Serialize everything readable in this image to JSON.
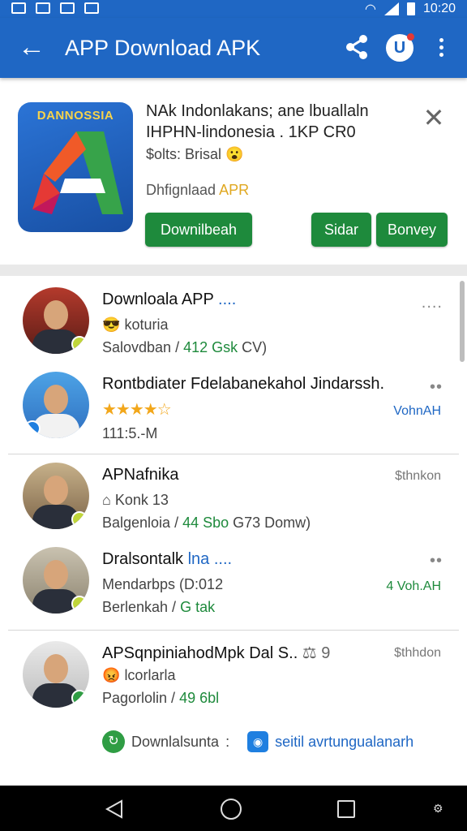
{
  "status_bar": {
    "time": "10:20"
  },
  "app_bar": {
    "title": "APP Download APK",
    "badge": "U"
  },
  "top_card": {
    "logo_text": "DANNOSSIA",
    "title": "NAk Indonlakans; ane lbuallaln IHPHN-lindonesia . 1KP CR0",
    "subtitle": "$olts: Brisal",
    "subtitle_emoji": "😮",
    "download_prefix": "Dhfignlaad ",
    "download_accent": "APR",
    "buttons": {
      "primary": "Downilbeah",
      "second": "Sidar",
      "third": "Bonvey"
    }
  },
  "list": [
    {
      "name": "Downloala APP",
      "name_accent": " ....",
      "sub_icon": "😎",
      "sub": "koturia",
      "meta": "Salovdban / ",
      "meta_green": "412 Gsk",
      "meta_tail": " CV)",
      "right": "....",
      "right_type": "dots"
    },
    {
      "name": "Rontbdiater Fdelabanekahol Jindarssh.",
      "sub_stars": "★★★★☆",
      "meta": "111:5.-M",
      "right": "••",
      "right_type": "dots",
      "right2": "VohnAH",
      "right2_type": "blue"
    },
    {
      "name": "APNafnika",
      "sub_icon": "⌂",
      "sub": "Konk 13",
      "meta": "Balgenloia / ",
      "meta_green": "44 Sbo",
      "meta_tail": " G73 Domw)",
      "right": "$thnkon",
      "right_type": "gray"
    },
    {
      "name": "Dralsontalk",
      "name_accent": " lna ....",
      "sub": "Mendarbps (D:012",
      "meta": "Berlenkah / ",
      "meta_green": "G tak",
      "right": "••",
      "right_type": "dots",
      "right2": "4 Voh.AH",
      "right2_type": "green"
    },
    {
      "name": "APSqnpiniahodMpk Dal S..",
      "name_tail": " ⚖ 9",
      "sub_icon": "😡",
      "sub": "lcorlarla",
      "meta": "Pagorlolin / ",
      "meta_green": "49 6bl",
      "right": "$thhdon",
      "right_type": "gray"
    }
  ],
  "footer": {
    "left": "Downlalsunta",
    "sep": ":",
    "link": "seitil avrtungualanarh"
  }
}
